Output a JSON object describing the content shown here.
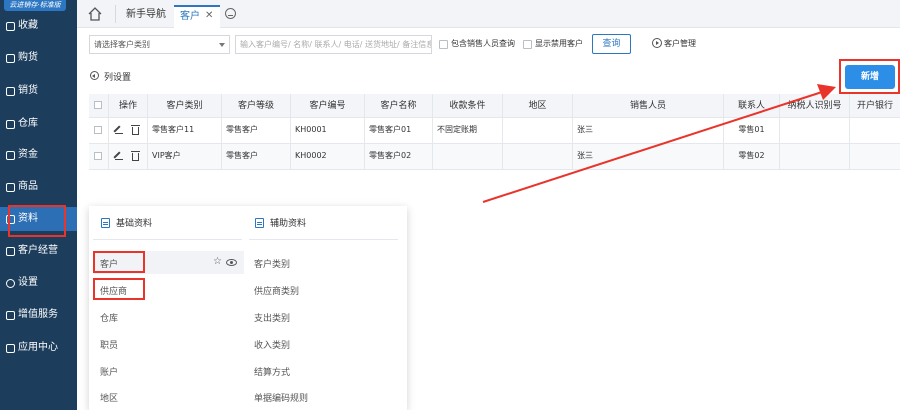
{
  "app": {
    "edition_badge": "云进销存·标准版"
  },
  "sidebar": {
    "items": [
      {
        "label": "收藏",
        "icon": "star-icon"
      },
      {
        "label": "购货",
        "icon": "cart-icon"
      },
      {
        "label": "销货",
        "icon": "sales-icon"
      },
      {
        "label": "仓库",
        "icon": "warehouse-icon"
      },
      {
        "label": "资金",
        "icon": "money-icon"
      },
      {
        "label": "商品",
        "icon": "product-icon"
      },
      {
        "label": "资料",
        "icon": "data-icon",
        "active": true
      },
      {
        "label": "客户经营",
        "icon": "customer-icon"
      },
      {
        "label": "设置",
        "icon": "gear-icon"
      },
      {
        "label": "增值服务",
        "icon": "service-icon"
      },
      {
        "label": "应用中心",
        "icon": "app-icon"
      }
    ]
  },
  "tabs": {
    "nav": "新手导航",
    "customer": "客户",
    "close": "✕"
  },
  "filters": {
    "category_placeholder": "请选择客户类别",
    "search_placeholder": "输入客户编号/ 名称/ 联系人/ 电话/ 送货地址/ 备注信息",
    "include_sales_label": "包含销售人员查询",
    "show_disabled_label": "显示禁用客户",
    "query_label": "查询",
    "management_label": "客户管理"
  },
  "toolbar": {
    "column_settings": "列设置",
    "add_label": "新增"
  },
  "table": {
    "columns": [
      "操作",
      "客户类别",
      "客户等级",
      "客户编号",
      "客户名称",
      "收款条件",
      "地区",
      "销售人员",
      "联系人",
      "纳税人识别号",
      "开户银行"
    ],
    "rows": [
      {
        "category": "零售客户11",
        "level": "零售客户",
        "code": "KH0001",
        "name": "零售客户01",
        "terms": "不固定账期",
        "region": "",
        "sales": "张三",
        "contact": "零售01",
        "tax_id": "",
        "bank": ""
      },
      {
        "category": "VIP客户",
        "level": "零售客户",
        "code": "KH0002",
        "name": "零售客户02",
        "terms": "",
        "region": "",
        "sales": "张三",
        "contact": "零售02",
        "tax_id": "",
        "bank": ""
      }
    ]
  },
  "panel": {
    "basic_title": "基础资料",
    "aux_title": "辅助资料",
    "basic_items": [
      "客户",
      "供应商",
      "仓库",
      "职员",
      "账户",
      "地区"
    ],
    "aux_items": [
      "客户类别",
      "供应商类别",
      "支出类别",
      "收入类别",
      "结算方式",
      "单据编码规则"
    ]
  },
  "colors": {
    "sidebar_bg": "#1c3d5c",
    "accent": "#2d8ee8",
    "annotation_red": "#e8342b"
  }
}
